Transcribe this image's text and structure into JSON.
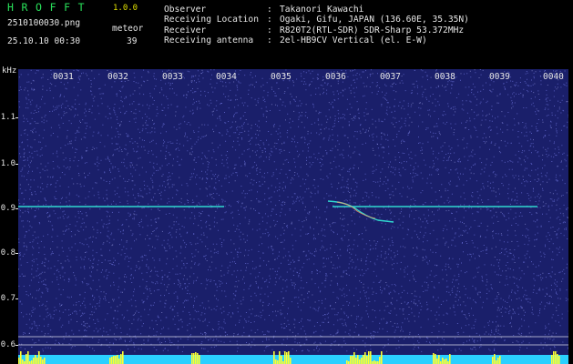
{
  "header": {
    "brand": "HROFFT",
    "version": "1.0.0",
    "filename": "2510100030.png",
    "datetime": "25.10.10 00:30",
    "meteor_label": "meteor",
    "meteor_count": "39"
  },
  "info": [
    {
      "key": "Observer",
      "value": "Takanori Kawachi"
    },
    {
      "key": "Receiving Location",
      "value": "Ogaki, Gifu, JAPAN (136.60E, 35.35N)"
    },
    {
      "key": "Receiver",
      "value": "R820T2(RTL-SDR) SDR-Sharp 53.372MHz"
    },
    {
      "key": "Receiving antenna",
      "value": "2el-HB9CV Vertical (el. E-W)"
    }
  ],
  "axis": {
    "unit_label": "kHz",
    "y_ticks": [
      "1.1",
      "1.0",
      "0.9",
      "0.8",
      "0.7",
      "0.6"
    ],
    "x_ticks": [
      "0031",
      "0032",
      "0033",
      "0034",
      "0035",
      "0036",
      "0037",
      "0038",
      "0039",
      "0040"
    ]
  },
  "colors": {
    "background": "#1a1f6a",
    "noise_dot": "#6a70d8",
    "carrier": "#30d8d0",
    "meteor_trail": "#ffffff",
    "bottom_band": "#2ad0ff",
    "burst": "#ffff30",
    "brand": "#29e05a",
    "version": "#e0e000"
  }
}
